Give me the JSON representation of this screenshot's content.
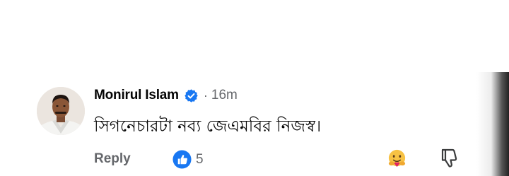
{
  "comment": {
    "author": "Monirul Islam",
    "separator": "·",
    "time": "16m",
    "text": "সিগনেচারটা নব্য জেএমবির নিজস্ব।",
    "reply_label": "Reply",
    "like_count": "5"
  },
  "icons": {
    "avatar": "profile-photo",
    "verified": "verified-check-icon",
    "like": "thumbs-up-icon",
    "react": "hugging-face-emoji-icon",
    "dislike": "thumbs-down-icon"
  },
  "colors": {
    "verified": "#1877f2",
    "like": "#1877f2",
    "secondary_text": "#65676b",
    "primary_text": "#050505"
  }
}
